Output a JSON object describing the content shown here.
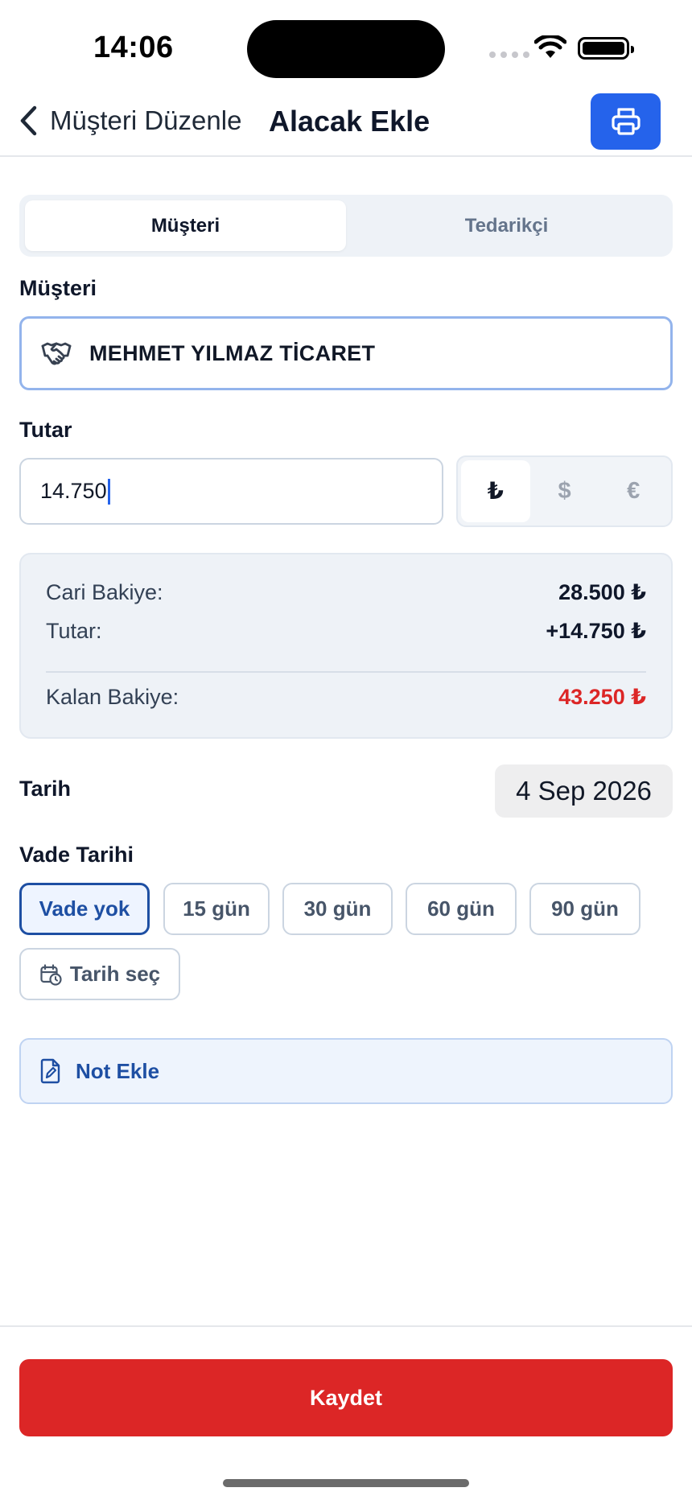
{
  "status_bar": {
    "time": "14:06"
  },
  "nav": {
    "back_label": "Müşteri Düzenle",
    "title": "Alacak Ekle"
  },
  "segment": {
    "options": [
      "Müşteri",
      "Tedarikçi"
    ],
    "selected": "Müşteri"
  },
  "customer": {
    "label": "Müşteri",
    "name": "MEHMET YILMAZ TİCARET"
  },
  "amount": {
    "label": "Tutar",
    "value": "14.750",
    "currencies": [
      "₺",
      "$",
      "€"
    ],
    "selected_currency": "₺"
  },
  "summary": {
    "current_balance_label": "Cari Bakiye:",
    "current_balance_value": "28.500 ₺",
    "amount_label": "Tutar:",
    "amount_value": "+14.750 ₺",
    "remaining_label": "Kalan Bakiye:",
    "remaining_value": "43.250 ₺",
    "accent_color": "#dc2626"
  },
  "date": {
    "label": "Tarih",
    "value": "4 Sep 2026"
  },
  "due": {
    "label": "Vade Tarihi",
    "options": [
      "Vade yok",
      "15 gün",
      "30 gün",
      "60 gün",
      "90 gün"
    ],
    "selected": "Vade yok",
    "pick_date_label": "Tarih seç"
  },
  "note": {
    "label": "Not Ekle"
  },
  "save": {
    "label": "Kaydet",
    "color": "#dc2626"
  },
  "brand_color": "#2563eb"
}
